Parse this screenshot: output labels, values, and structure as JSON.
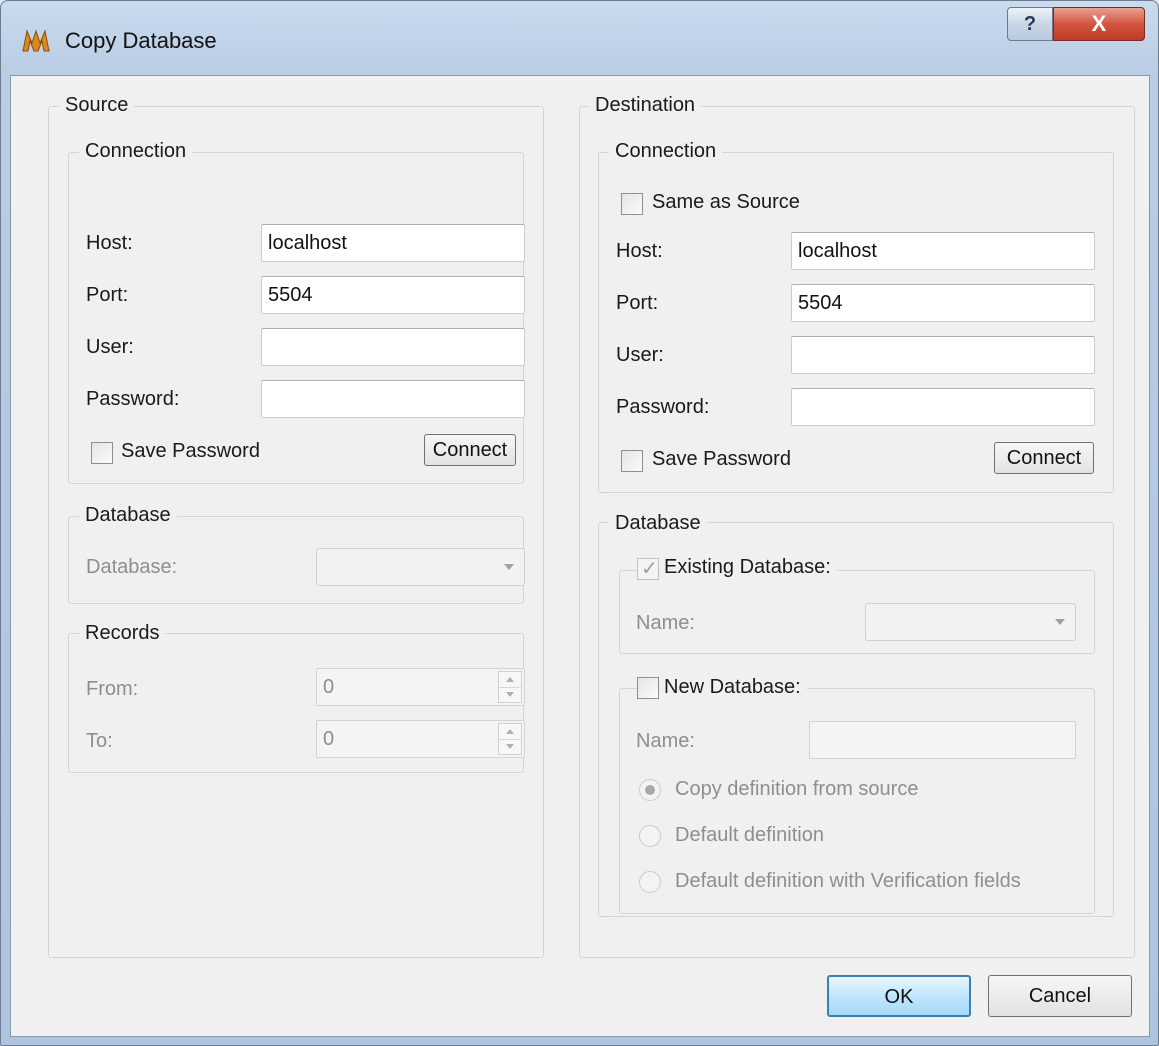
{
  "window": {
    "title": "Copy Database",
    "help_label": "?",
    "close_label": "X"
  },
  "source": {
    "legend": "Source",
    "connection": {
      "legend": "Connection",
      "host_label": "Host:",
      "host_value": "localhost",
      "port_label": "Port:",
      "port_value": "5504",
      "user_label": "User:",
      "user_value": "",
      "password_label": "Password:",
      "password_value": "",
      "save_password_label": "Save Password",
      "save_password_checked": false,
      "connect_label": "Connect"
    },
    "database": {
      "legend": "Database",
      "database_label": "Database:",
      "database_value": ""
    },
    "records": {
      "legend": "Records",
      "from_label": "From:",
      "from_value": "0",
      "to_label": "To:",
      "to_value": "0"
    }
  },
  "destination": {
    "legend": "Destination",
    "connection": {
      "legend": "Connection",
      "same_as_source_label": "Same as Source",
      "same_as_source_checked": false,
      "host_label": "Host:",
      "host_value": "localhost",
      "port_label": "Port:",
      "port_value": "5504",
      "user_label": "User:",
      "user_value": "",
      "password_label": "Password:",
      "password_value": "",
      "save_password_label": "Save Password",
      "save_password_checked": false,
      "connect_label": "Connect"
    },
    "database": {
      "legend": "Database",
      "existing": {
        "label": "Existing Database:",
        "checked": true,
        "name_label": "Name:",
        "name_value": ""
      },
      "new": {
        "label": "New Database:",
        "checked": false,
        "name_label": "Name:",
        "name_value": "",
        "options": [
          "Copy definition from source",
          "Default definition",
          "Default definition with Verification fields"
        ],
        "selected": "Copy definition from source"
      }
    }
  },
  "footer": {
    "ok_label": "OK",
    "cancel_label": "Cancel"
  },
  "colors": {
    "title_bar": "#b9cde4",
    "close_button": "#c8412c",
    "ok_border": "#3c7fb1"
  }
}
